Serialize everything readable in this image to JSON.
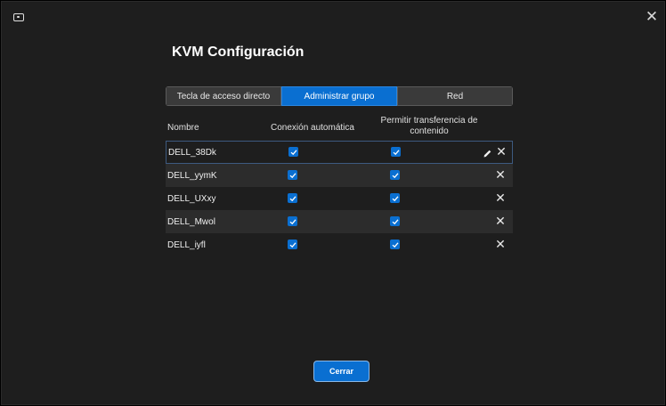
{
  "window": {
    "title": "KVM Configuración",
    "close_symbol": "✕"
  },
  "tabs": [
    {
      "label": "Tecla de acceso directo",
      "active": false
    },
    {
      "label": "Administrar grupo",
      "active": true
    },
    {
      "label": "Red",
      "active": false
    }
  ],
  "table": {
    "headers": {
      "name": "Nombre",
      "auto_connect": "Conexión automática",
      "transfer": "Permitir transferencia de contenido"
    },
    "rows": [
      {
        "name": "DELL_38Dk",
        "auto_connect": true,
        "transfer": true,
        "selected": true
      },
      {
        "name": "DELL_yymK",
        "auto_connect": true,
        "transfer": true,
        "selected": false
      },
      {
        "name": "DELL_UXxy",
        "auto_connect": true,
        "transfer": true,
        "selected": false
      },
      {
        "name": "DELL_Mwol",
        "auto_connect": true,
        "transfer": true,
        "selected": false
      },
      {
        "name": "DELL_iyfl",
        "auto_connect": true,
        "transfer": true,
        "selected": false
      }
    ],
    "delete_symbol": "✕"
  },
  "footer": {
    "close_label": "Cerrar"
  },
  "colors": {
    "accent": "#0a6fd1",
    "background": "#1e1e1e",
    "row_alt": "#2c2c2c"
  }
}
